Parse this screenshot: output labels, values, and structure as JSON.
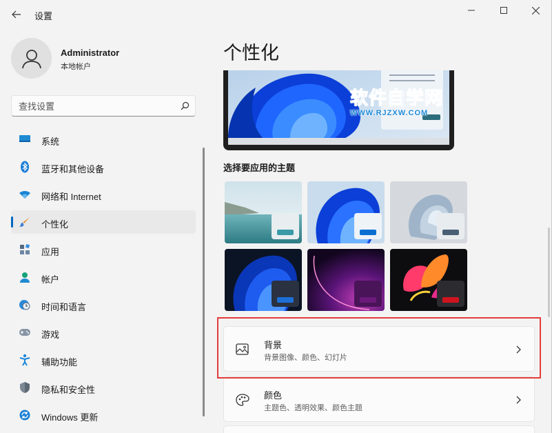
{
  "window": {
    "app_title": "设置"
  },
  "user": {
    "name": "Administrator",
    "account_type": "本地帐户"
  },
  "search": {
    "placeholder": "查找设置"
  },
  "nav": {
    "items": [
      {
        "label": "系统",
        "icon": "monitor-icon"
      },
      {
        "label": "蓝牙和其他设备",
        "icon": "bluetooth-icon"
      },
      {
        "label": "网络和 Internet",
        "icon": "wifi-icon"
      },
      {
        "label": "个性化",
        "icon": "brush-icon",
        "active": true
      },
      {
        "label": "应用",
        "icon": "apps-icon"
      },
      {
        "label": "帐户",
        "icon": "person-icon"
      },
      {
        "label": "时间和语言",
        "icon": "clock-globe-icon"
      },
      {
        "label": "游戏",
        "icon": "gamepad-icon"
      },
      {
        "label": "辅助功能",
        "icon": "accessibility-icon"
      },
      {
        "label": "隐私和安全性",
        "icon": "shield-icon"
      },
      {
        "label": "Windows 更新",
        "icon": "update-icon"
      }
    ]
  },
  "page": {
    "title": "个性化"
  },
  "watermark": {
    "main": "软件自学网",
    "url": "WWW.RJZXW.COM"
  },
  "themes": {
    "label": "选择要应用的主题",
    "items": [
      {
        "name": "lake-theme",
        "accent": "#3a9aa8"
      },
      {
        "name": "windows-light-theme",
        "accent": "#0a6fd1"
      },
      {
        "name": "glow-theme",
        "accent": "#4a5f73"
      },
      {
        "name": "windows-dark-theme",
        "accent": "#1d6fd6"
      },
      {
        "name": "captured-motion-theme",
        "accent": "#6b1a7a"
      },
      {
        "name": "flow-theme",
        "accent": "#d0141f"
      }
    ]
  },
  "settings": {
    "background": {
      "title": "背景",
      "subtitle": "背景图像、颜色、幻灯片"
    },
    "colors": {
      "title": "颜色",
      "subtitle": "主题色、透明效果、颜色主题"
    }
  },
  "colors": {
    "accent": "#0067c0",
    "highlight_box": "#e23b3b"
  }
}
